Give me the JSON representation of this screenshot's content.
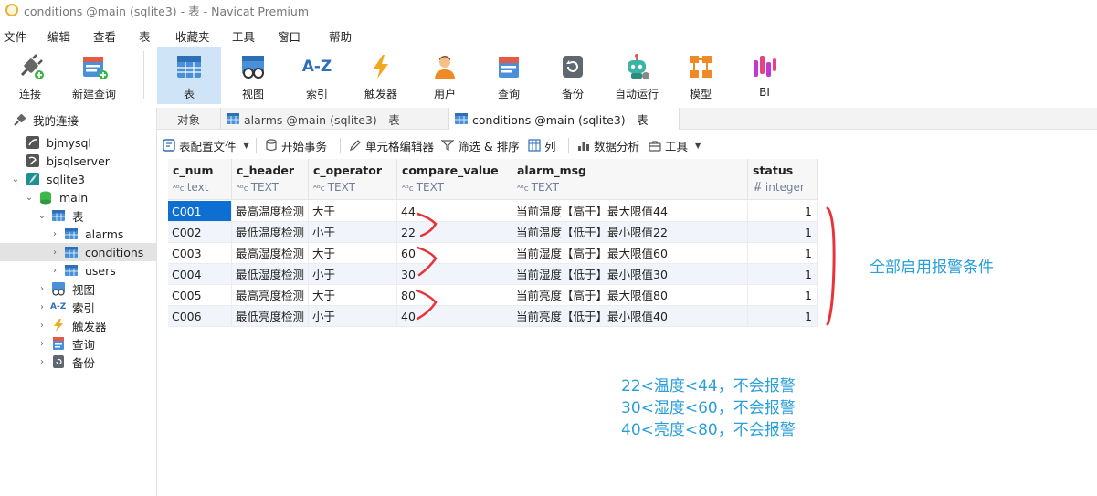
{
  "window": {
    "title": "conditions @main (sqlite3) - 表 - Navicat Premium"
  },
  "menu": [
    "文件",
    "编辑",
    "查看",
    "表",
    "收藏夹",
    "工具",
    "窗口",
    "帮助"
  ],
  "toolbar": {
    "connect": "连接",
    "new_query": "新建查询",
    "table": "表",
    "view": "视图",
    "index": "索引",
    "trigger": "触发器",
    "user": "用户",
    "query": "查询",
    "backup": "备份",
    "automation": "自动运行",
    "model": "模型",
    "bi": "BI",
    "index_icon_text": "A-Z"
  },
  "sidebar": {
    "my_connections": "我的连接",
    "bjmysql": "bjmysql",
    "bjsqlserver": "bjsqlserver",
    "sqlite3": "sqlite3",
    "main": "main",
    "tables": "表",
    "alarms": "alarms",
    "conditions": "conditions",
    "users": "users",
    "views": "视图",
    "indexes": "索引",
    "triggers": "触发器",
    "queries": "查询",
    "backups": "备份",
    "index_icon_text": "A-Z"
  },
  "tabs": {
    "objects": "对象",
    "alarms": "alarms @main (sqlite3) - 表",
    "conditions": "conditions @main (sqlite3) - 表"
  },
  "subtoolbar": {
    "table_profile": "表配置文件",
    "begin_transaction": "开始事务",
    "cell_editor": "单元格编辑器",
    "filter_sort": "筛选 & 排序",
    "columns": "列",
    "data_analysis": "数据分析",
    "tools": "工具"
  },
  "table": {
    "columns": [
      {
        "name": "c_num",
        "type": "text"
      },
      {
        "name": "c_header",
        "type": "TEXT"
      },
      {
        "name": "c_operator",
        "type": "TEXT"
      },
      {
        "name": "compare_value",
        "type": "TEXT"
      },
      {
        "name": "alarm_msg",
        "type": "TEXT"
      },
      {
        "name": "status",
        "type": "integer"
      }
    ],
    "rows": [
      [
        "C001",
        "最高温度检测",
        "大于",
        "44",
        "当前温度【高于】最大限值44",
        "1"
      ],
      [
        "C002",
        "最低温度检测",
        "小于",
        "22",
        "当前温度【低于】最小限值22",
        "1"
      ],
      [
        "C003",
        "最高湿度检测",
        "大于",
        "60",
        "当前湿度【高于】最大限值60",
        "1"
      ],
      [
        "C004",
        "最低湿度检测",
        "小于",
        "30",
        "当前湿度【低于】最小限值30",
        "1"
      ],
      [
        "C005",
        "最高亮度检测",
        "大于",
        "80",
        "当前亮度【高于】最大限值80",
        "1"
      ],
      [
        "C006",
        "最低亮度检测",
        "小于",
        "40",
        "当前亮度【低于】最小限值40",
        "1"
      ]
    ]
  },
  "annotations": {
    "all_enabled": "全部启用报警条件",
    "temperature_note": "22<温度<44，不会报警",
    "humidity_note": "30<湿度<60，不会报警",
    "brightness_note": "40<亮度<80，不会报警"
  },
  "colors": {
    "accent": "#0c6fd1",
    "annotation_text": "#2a9fd8",
    "annotation_marks": "#e8333a",
    "active_toolbar": "#cfe4f7"
  }
}
